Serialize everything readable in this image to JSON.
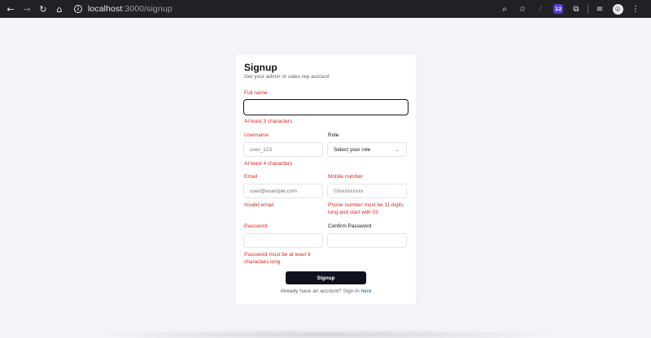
{
  "browser": {
    "url_host": "localhost",
    "url_path": ":3000/signup",
    "extension_badge": "12",
    "icons": [
      "back-icon",
      "forward-icon",
      "reload-icon",
      "home-icon",
      "site-info-icon",
      "zoom-icon",
      "bookmark-star-icon",
      "extension-icon",
      "extensions-puzzle-icon",
      "reading-list-icon",
      "profile-avatar",
      "menu-kebab-icon"
    ]
  },
  "form": {
    "title": "Signup",
    "subtitle": "Get your admin or sales rep account",
    "full_name": {
      "label": "Full name",
      "value": "",
      "placeholder": "",
      "error": "At least 3 characters"
    },
    "username": {
      "label": "Username",
      "placeholder": "user_123",
      "error": "At least 4 characters"
    },
    "role": {
      "label": "Role",
      "selected": "Select your role"
    },
    "email": {
      "label": "Email",
      "placeholder": "user@example.com",
      "error": "Invalid email"
    },
    "mobile": {
      "label": "Mobile number",
      "placeholder": "03xxxxxxxxx",
      "error_line1": "Phone number must be 11 digits",
      "error_line2": "long and start with 03"
    },
    "password": {
      "label": "Password",
      "placeholder": "",
      "error_line1": "Password must be at least 8",
      "error_line2": "characters long"
    },
    "confirm_password": {
      "label": "Confirm Password",
      "placeholder": ""
    },
    "submit_label": "Signup",
    "footer_text": "Already have an account? Sign-in",
    "footer_link": "here"
  },
  "colors": {
    "error": "#d9281e",
    "button": "#0f1120",
    "link": "#1d4ed8",
    "page_bg": "#f3f4f8"
  }
}
